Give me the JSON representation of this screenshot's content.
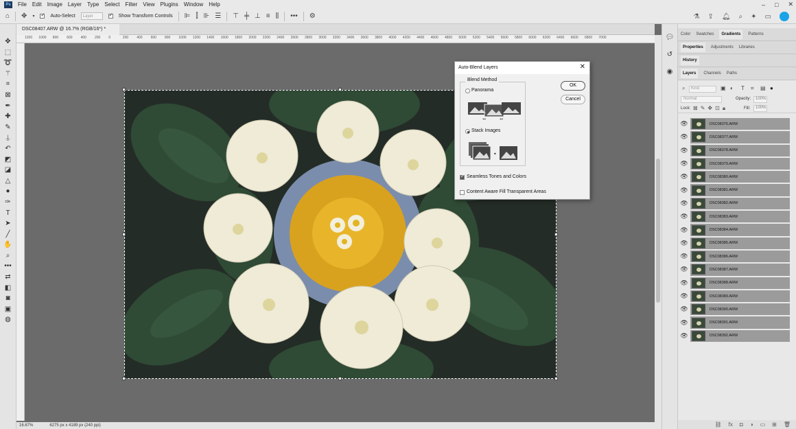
{
  "menu": [
    "File",
    "Edit",
    "Image",
    "Layer",
    "Type",
    "Select",
    "Filter",
    "View",
    "Plugins",
    "Window",
    "Help"
  ],
  "app_logo": "Ps",
  "window_controls": [
    "–",
    "□",
    "✕"
  ],
  "options_bar": {
    "auto_select_label": "Auto-Select",
    "auto_select_target": "Layer",
    "show_transform_label": "Show Transform Controls"
  },
  "document": {
    "tab_title": "DSC08407.ARW @ 16.7% (RGB/16*) *",
    "zoom": "16.67%",
    "dimensions": "6275 px x 4189 px (240 ppi)"
  },
  "ruler_marks": [
    "1200",
    "1000",
    "800",
    "600",
    "400",
    "200",
    "0",
    "200",
    "400",
    "600",
    "800",
    "1000",
    "1200",
    "1400",
    "1600",
    "1800",
    "2000",
    "2200",
    "2400",
    "2600",
    "2800",
    "3000",
    "3200",
    "3400",
    "3600",
    "3800",
    "4000",
    "4200",
    "4400",
    "4600",
    "4800",
    "5000",
    "5200",
    "5400",
    "5600",
    "5800",
    "6000",
    "6200",
    "6400",
    "6600",
    "6800",
    "7000"
  ],
  "right_panels": {
    "top_tabs": [
      "Color",
      "Swatches",
      "Gradients",
      "Patterns"
    ],
    "top_active": "Gradients",
    "mid_tabs": [
      "Properties",
      "Adjustments",
      "Libraries"
    ],
    "mid_active": "Properties",
    "history_tab": "History",
    "layer_tabs": [
      "Layers",
      "Channels",
      "Paths"
    ],
    "layers_active": "Layers",
    "kind_placeholder": "Kind",
    "blend_mode": "Normal",
    "opacity_label": "Opacity:",
    "opacity_value": "100%",
    "lock_label": "Lock:",
    "fill_label": "Fill:",
    "fill_value": "100%"
  },
  "layers": [
    "DSC08376.ARW",
    "DSC08377.ARW",
    "DSC08378.ARW",
    "DSC08379.ARW",
    "DSC08380.ARW",
    "DSC08381.ARW",
    "DSC08382.ARW",
    "DSC08383.ARW",
    "DSC08384.ARW",
    "DSC08385.ARW",
    "DSC08386.ARW",
    "DSC08387.ARW",
    "DSC08388.ARW",
    "DSC08389.ARW",
    "DSC08390.ARW",
    "DSC08391.ARW",
    "DSC08392.ARW"
  ],
  "dialog": {
    "title": "Auto-Blend Layers",
    "blend_method_label": "Blend Method",
    "panorama_label": "Panorama",
    "stack_images_label": "Stack Images",
    "selected_method": "Stack Images",
    "seamless_label": "Seamless Tones and Colors",
    "seamless_checked": true,
    "content_aware_label": "Content Aware Fill Transparent Areas",
    "content_aware_checked": false,
    "ok_label": "OK",
    "cancel_label": "Cancel"
  },
  "colors": {
    "accent": "#1aa3e8",
    "canvas_bg": "#6b6b6b",
    "layer_row": "#9b9b9b"
  }
}
